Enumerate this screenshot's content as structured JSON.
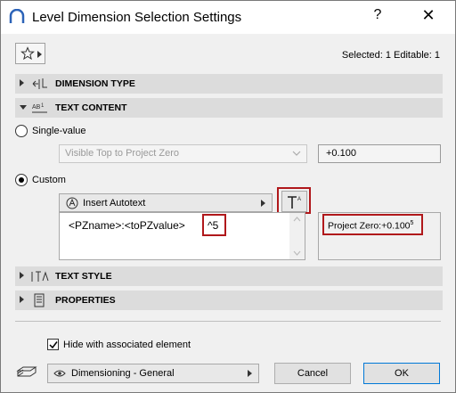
{
  "window": {
    "title": "Level Dimension Selection Settings",
    "help": "?",
    "close": "✕"
  },
  "header": {
    "selected_info": "Selected: 1 Editable: 1"
  },
  "sections": {
    "dimension_type": "DIMENSION TYPE",
    "text_content": "TEXT CONTENT",
    "text_style": "TEXT STYLE",
    "properties": "PROPERTIES"
  },
  "text_content": {
    "single_value_label": "Single-value",
    "single_value_select": "Visible Top to Project Zero",
    "single_value_value": "+0.100",
    "custom_label": "Custom",
    "insert_autotext": "Insert Autotext",
    "textarea_value": "<PZname>:<toPZvalue>",
    "textarea_superscript": "^5",
    "preview_text": "Project Zero:+0.100",
    "preview_sup": "5"
  },
  "footer": {
    "hide_checkbox_label": "Hide with associated element",
    "hide_checked": true,
    "layer_select": "Dimensioning - General",
    "cancel_label": "Cancel",
    "ok_label": "OK"
  }
}
